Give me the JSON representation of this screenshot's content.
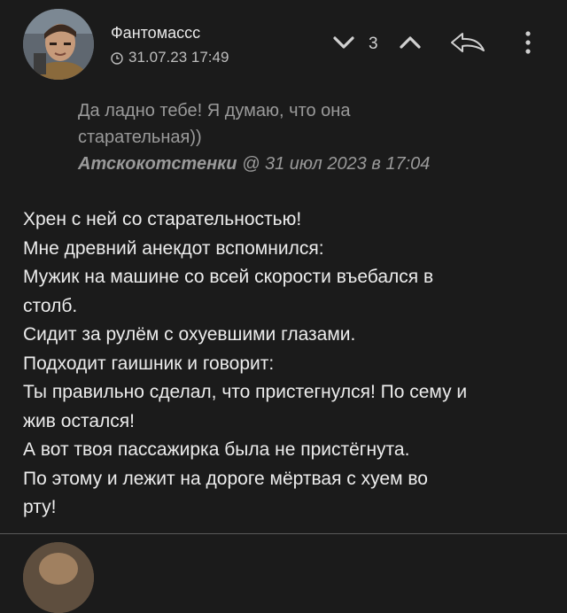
{
  "post": {
    "author": "Фантомассс",
    "timestamp": "31.07.23 17:49",
    "vote_count": "3",
    "icons": [
      "clock-icon",
      "downvote-icon",
      "upvote-icon",
      "reply-icon",
      "more-vertical-icon"
    ]
  },
  "quote": {
    "text_lines": [
      "Да ладно тебе! Я думаю, что она",
      "старательная))"
    ],
    "author": "Атскокотстенки",
    "at": "@",
    "date": "31 июл 2023 в 17:04"
  },
  "body": {
    "lines": [
      "Хрен с ней со старательностью!",
      "Мне древний анекдот вспомнился:",
      "Мужик на машине со всей скорости въебался в",
      "столб.",
      "Сидит за рулём с охуевшими глазами.",
      "Подходит гаишник и говорит:",
      "Ты правильно сделал, что пристегнулся! По сему и",
      "жив остался!",
      "А вот твоя пассажирка была не пристёгнута.",
      "По этому и лежит на дороге мёртвая с хуем во",
      "рту!"
    ]
  }
}
